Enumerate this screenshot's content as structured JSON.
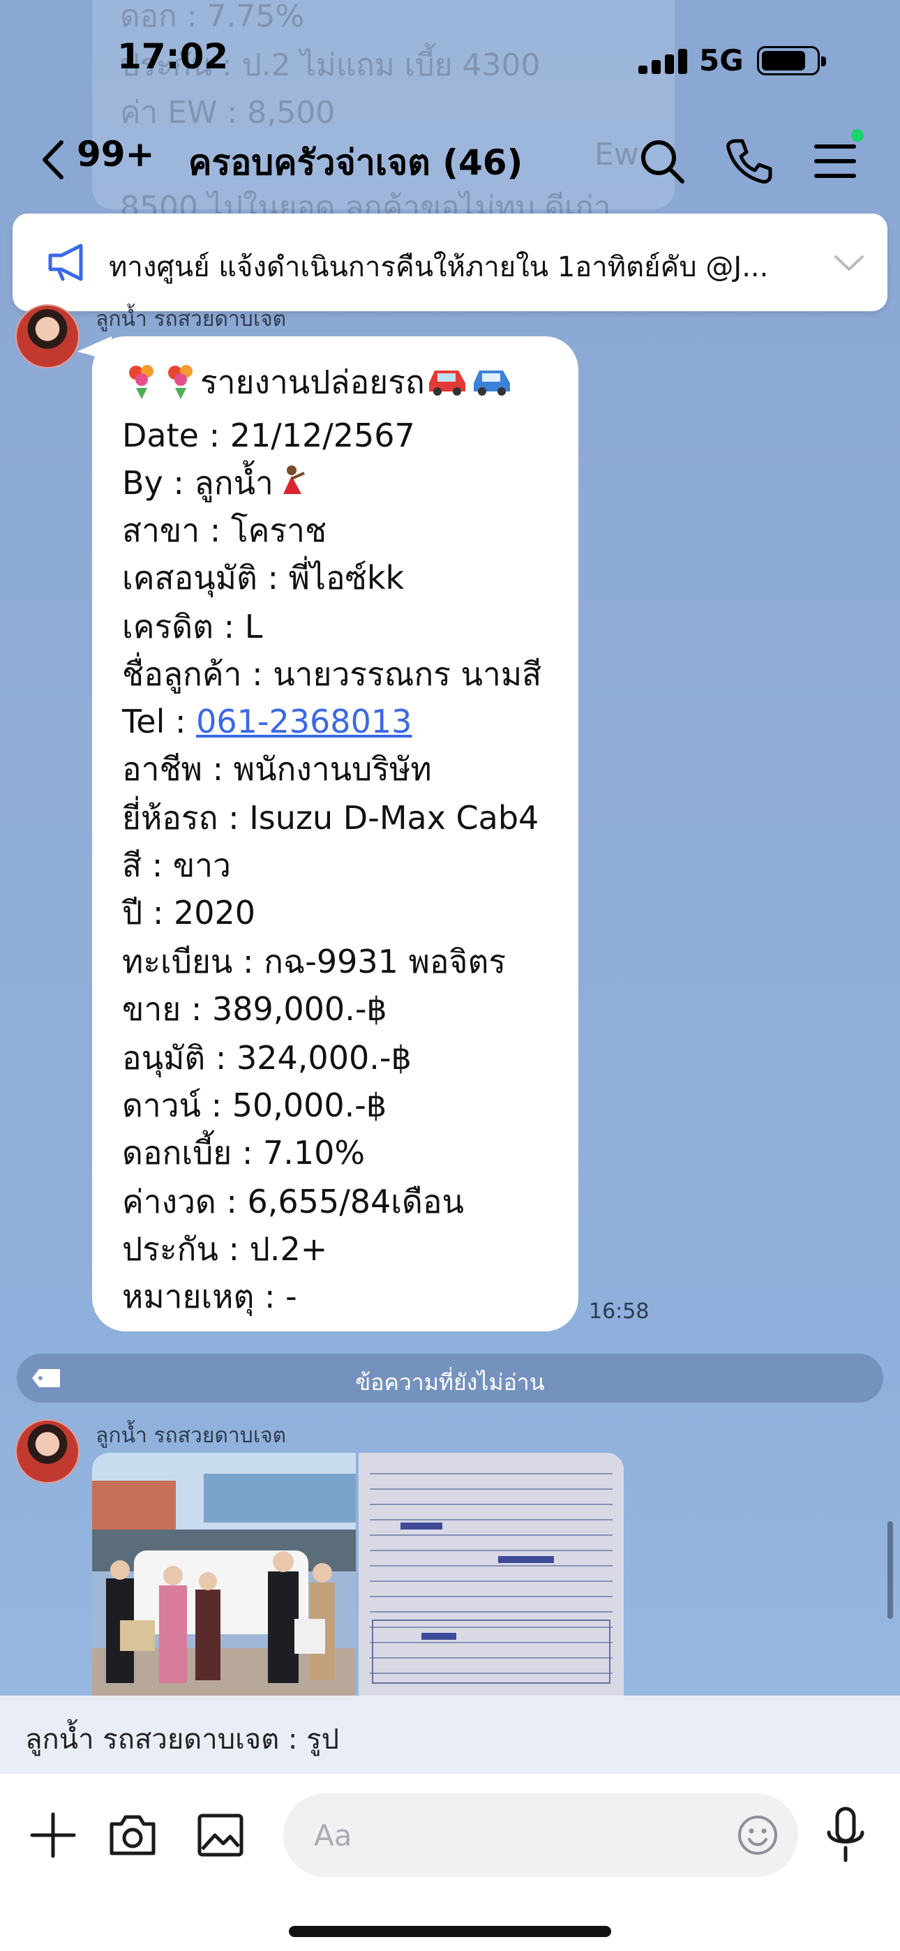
{
  "status_bar": {
    "time": "17:02",
    "network": "5G"
  },
  "background_previous_message": {
    "lines": [
      "ดอก : 7.75%",
      "ประกัน : ป.2 ไม่แถม เบี้ย 4300",
      "ค่า EW : 8,500",
      "Ew",
      "8500 ไปในยอด ลูกค้าขอไม่ทบ ดีเก่า"
    ]
  },
  "header": {
    "unread_count": "99+",
    "group_title": "ครอบครัวจ่าเจต (46)",
    "icons": [
      "back-icon",
      "search-icon",
      "phone-icon",
      "menu-icon"
    ]
  },
  "announcement": {
    "text": "ทางศูนย์ แจ้งดำเนินการคืนให้ภายใน 1อาทิตย์คับ @J...",
    "icon": "megaphone-icon"
  },
  "message": {
    "sender": "ลูกน้ำ รถสวยดาบเจต",
    "time": "16:58",
    "title": "รายงานปล่อยรถ",
    "lines": [
      "Date : 21/12/2567",
      "By : ลูกน้ำ",
      "สาขา : โคราช",
      "เคสอนุมัติ : พี่ไอซ์kk",
      "เครดิต : L",
      "ชื่อลูกค้า : นายวรรณกร นามสี",
      "Tel : ",
      "อาชีพ : พนักงานบริษัท",
      "ยี่ห้อรถ : Isuzu D-Max Cab4",
      "สี : ขาว",
      "ปี : 2020",
      "ทะเบียน : กฉ-9931 พอจิตร",
      "ขาย : 389,000.-฿",
      "อนุมัติ : 324,000.-฿",
      "ดาวน์ : 50,000.-฿",
      "ดอกเบี้ย : 7.10%",
      "ค่างวด : 6,655/84เดือน",
      "ประกัน : ป.2+",
      "หมายเหตุ : -"
    ],
    "phone": "061-2368013"
  },
  "unread_divider": {
    "label": "ข้อความที่ยังไม่อ่าน"
  },
  "photo_message": {
    "sender": "ลูกน้ำ รถสวยดาบเจต",
    "photos": [
      "customer-photo",
      "document-photo"
    ]
  },
  "preview_bar": {
    "text": "ลูกน้ำ รถสวยดาบเจต : รูป"
  },
  "input_bar": {
    "placeholder": "Aa",
    "icons": [
      "plus-icon",
      "camera-icon",
      "image-icon",
      "emoji-icon",
      "mic-icon"
    ]
  },
  "colors": {
    "background": "#8fabd6",
    "bubble": "#ffffff",
    "link": "#3a68e8",
    "online": "#19d46b"
  }
}
